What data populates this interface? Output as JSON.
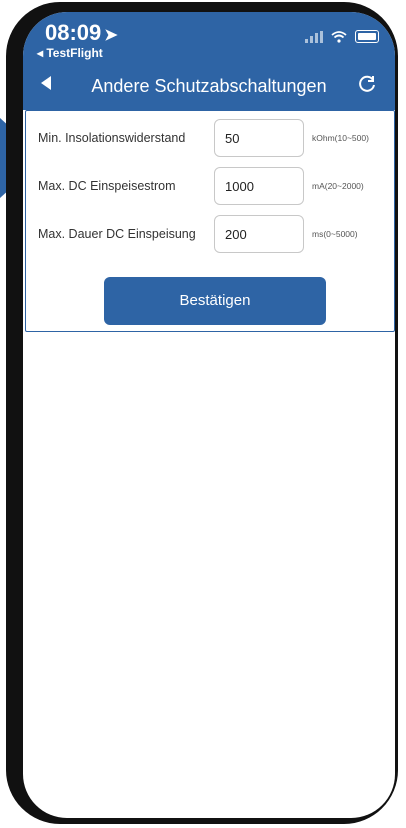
{
  "status": {
    "time": "08:09",
    "back_app": "◂ TestFlight"
  },
  "nav": {
    "title": "Andere Schutzabschaltungen"
  },
  "form": {
    "rows": [
      {
        "label": "Min. Insolationswiderstand",
        "value": "50",
        "unit": "kOhm(10~500)"
      },
      {
        "label": "Max. DC Einspeisestrom",
        "value": "1000",
        "unit": "mA(20~2000)"
      },
      {
        "label": "Max. Dauer DC Einspeisung",
        "value": "200",
        "unit": "ms(0~5000)"
      }
    ],
    "confirm_label": "Bestätigen"
  },
  "colors": {
    "accent": "#2e64a5"
  }
}
